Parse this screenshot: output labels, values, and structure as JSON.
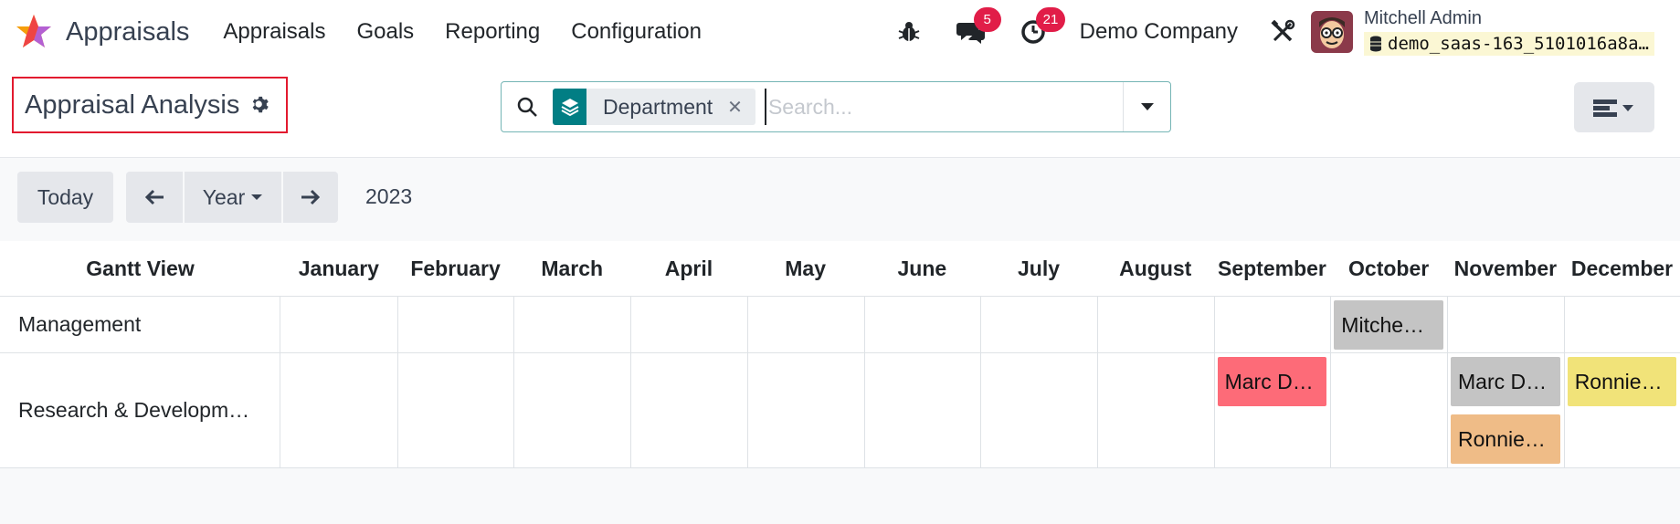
{
  "navbar": {
    "app_name": "Appraisals",
    "menu": [
      "Appraisals",
      "Goals",
      "Reporting",
      "Configuration"
    ],
    "messages_count": "5",
    "activities_count": "21",
    "company": "Demo Company",
    "user_name": "Mitchell Admin",
    "database": "demo_saas-163_5101016a8a…"
  },
  "control": {
    "title": "Appraisal Analysis",
    "facet_label": "Department",
    "search_placeholder": "Search..."
  },
  "toolbar": {
    "today_label": "Today",
    "scale_label": "Year",
    "range_label": "2023"
  },
  "gantt": {
    "header_title": "Gantt View",
    "months": [
      "January",
      "February",
      "March",
      "April",
      "May",
      "June",
      "July",
      "August",
      "September",
      "October",
      "November",
      "December"
    ],
    "rows": [
      {
        "label": "Management",
        "pills": [
          {
            "label": "Mitche…",
            "month": "October",
            "color": "#c4c4c4"
          }
        ]
      },
      {
        "label": "Research & Developm…",
        "pills": [
          {
            "label": "Marc D…",
            "month": "September",
            "color": "#fd6b78"
          },
          {
            "label": "Marc D…",
            "month": "November",
            "color": "#c4c4c4"
          },
          {
            "label": "Ronnie…",
            "month": "November",
            "color": "#efbc87"
          },
          {
            "label": "Ronnie…",
            "month": "December",
            "color": "#f1e379"
          }
        ]
      }
    ]
  },
  "colors": {
    "brand_teal": "#017e84",
    "badge_red": "#e11d48",
    "highlight_red": "#e21a2f"
  },
  "icons": [
    "odoo-star-logo",
    "bug-icon",
    "chat-icon",
    "clock-icon",
    "tools-icon",
    "database-icon",
    "gear-icon",
    "search-icon",
    "layers-icon",
    "close-icon",
    "caret-down-icon",
    "arrow-left-icon",
    "arrow-right-icon",
    "view-switcher-icon"
  ]
}
